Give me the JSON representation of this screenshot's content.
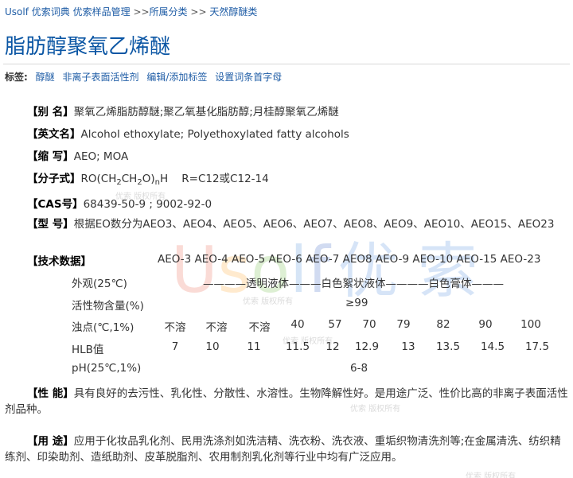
{
  "breadcrumb": {
    "site": "Usolf 优索词典",
    "section": "优索样品管理",
    "sep1": ">>",
    "category": "所属分类",
    "sep2": ">>",
    "subcategory": "天然醇醚类"
  },
  "page_title": "脂肪醇聚氧乙烯醚",
  "tags": {
    "label": "标签:",
    "items": [
      "醇醚",
      "非离子表面活性剂",
      "编辑/添加标签",
      "设置词条首字母"
    ]
  },
  "fields": {
    "alias": {
      "key": "【别  名】",
      "value": "聚氧乙烯脂肪醇醚;聚乙氧基化脂肪醇;月桂醇聚氧乙烯醚"
    },
    "english": {
      "key": "【英文名】",
      "value": "Alcohol ethoxylate; Polyethoxylated fatty alcohols"
    },
    "abbr": {
      "key": "【缩  写】",
      "value": "AEO; MOA"
    },
    "formula": {
      "key": "【分子式】",
      "prefix": "RO(CH",
      "sub1": "2",
      "mid1": "CH",
      "sub2": "2",
      "mid2": "O)",
      "subn": "n",
      "suffix": "H    R=C12或C12-14"
    },
    "cas": {
      "key": "【CAS号】",
      "value": "68439-50-9 ; 9002-92-0"
    },
    "model": {
      "key": "【型  号】",
      "value": "根据EO数分为AEO3、AEO4、AEO5、AEO6、AEO7、AEO8、AEO9、AEO10、AEO15、AEO23"
    },
    "tech": {
      "key": "【技术数据】"
    },
    "performance": {
      "key": "【性  能】",
      "value": "具有良好的去污性、乳化性、分散性、水溶性。生物降解性好。是用途广泛、性价比高的非离子表面活性剂品种。"
    },
    "usage": {
      "key": "【用  途】",
      "value": "应用于化妆品乳化剂、民用洗涤剂如洗洁精、洗衣粉、洗衣液、重垢织物清洗剂等;在金属清洗、纺织精练剂、印染助剂、造纸助剂、皮革脱脂剂、农用制剂乳化剂等行业中均有广泛应用。"
    }
  },
  "tech_table": {
    "models": "AEO-3 AEO-4 AEO-5 AEO-6 AEO-7 AEO8 AEO-9 AEO-10 AEO-15 AEO-23",
    "appearance": {
      "label": "外观(25℃)",
      "value": "————透明液体———白色絮状液体————白色膏体———"
    },
    "active": {
      "label": "活性物含量(%)",
      "value": "≥99"
    },
    "cloud": {
      "label": "浊点(℃,1%)",
      "values": [
        "不溶",
        "不溶",
        "不溶",
        "40",
        "57",
        "70",
        "79",
        "82",
        "90",
        "100"
      ]
    },
    "hlb": {
      "label": "HLB值",
      "values": [
        "7",
        "10",
        "11",
        "11.5",
        "12",
        "12.9",
        "13",
        "13.5",
        "14.5",
        "17.5"
      ]
    },
    "ph": {
      "label": "pH(25℃,1%)",
      "value": "6-8"
    }
  },
  "watermark": {
    "latin": "Usolf",
    "cn": "优索",
    "stamp": "优索 版权所有"
  }
}
